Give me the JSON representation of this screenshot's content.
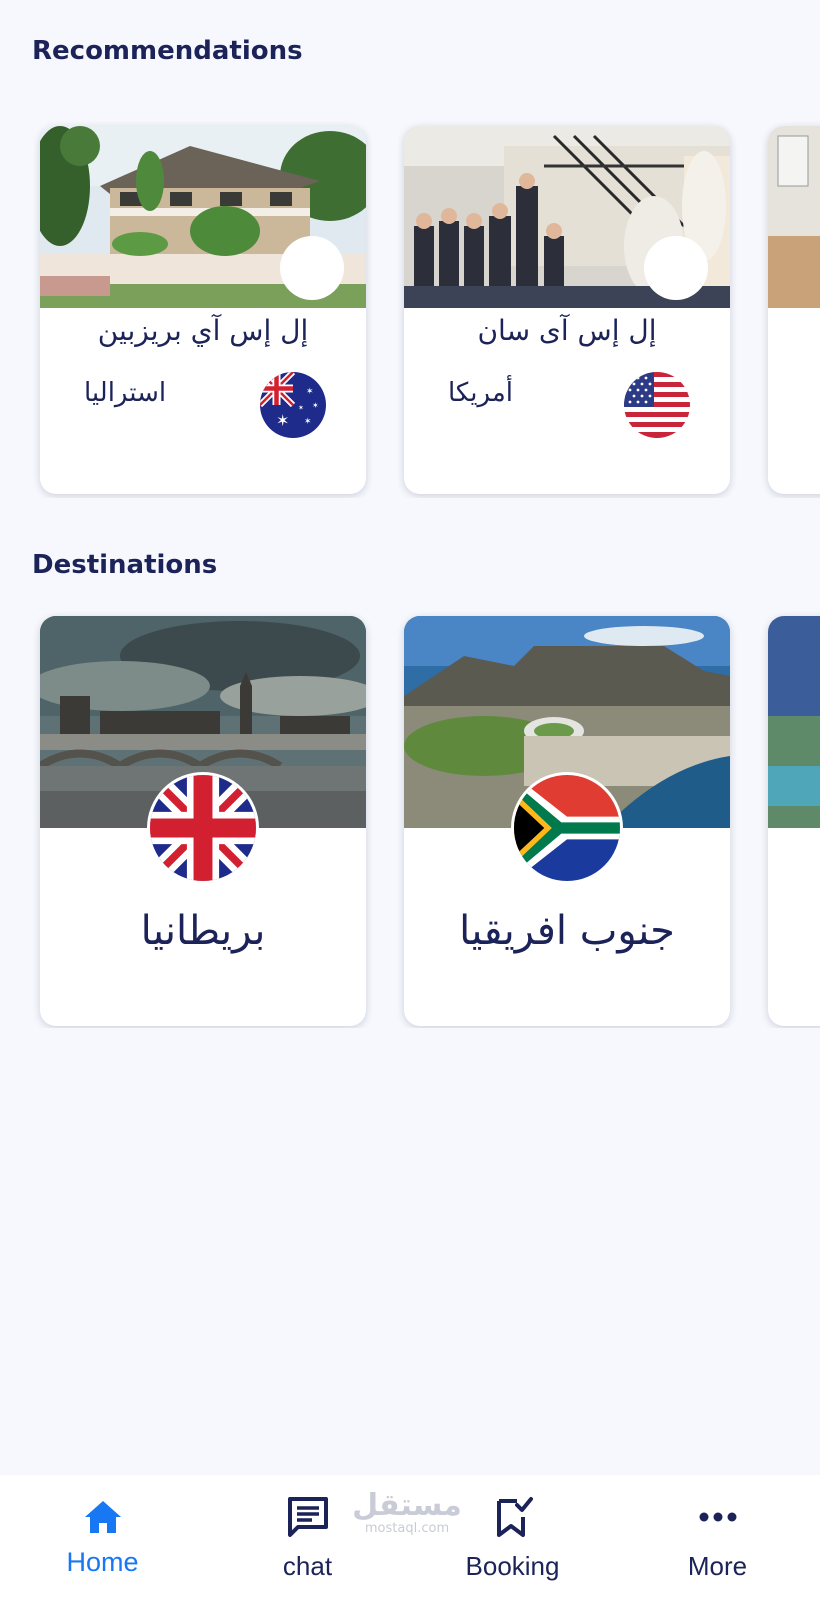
{
  "recommendations": {
    "title": "Recommendations",
    "cards": [
      {
        "school": "إل إس آي بريزبين",
        "country": "استراليا",
        "flag": "australia-flag"
      },
      {
        "school": "إل إس آى سان",
        "country": "أمريكا",
        "flag": "usa-flag"
      }
    ]
  },
  "destinations": {
    "title": "Destinations",
    "cards": [
      {
        "country": "بريطانيا",
        "flag": "uk-flag"
      },
      {
        "country": "جنوب افريقيا",
        "flag": "south-africa-flag"
      }
    ]
  },
  "nav": {
    "home": "Home",
    "chat": "chat",
    "booking": "Booking",
    "more": "More",
    "active": "home"
  },
  "watermark": {
    "arabic": "مستقل",
    "latin": "mostaql.com"
  },
  "colors": {
    "background": "#f6f8fd",
    "text": "#1b2358",
    "accent": "#1877f2"
  }
}
